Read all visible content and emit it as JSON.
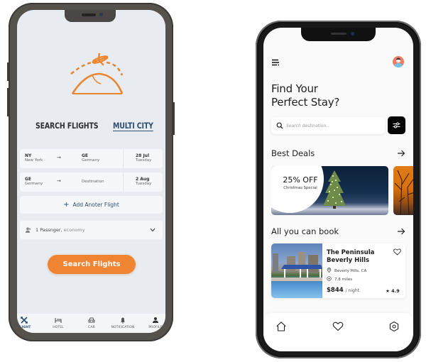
{
  "flight_app": {
    "mode_tabs": [
      {
        "label": "SEARCH FLIGHTS",
        "active": false
      },
      {
        "label": "MULTI CITY",
        "active": true
      }
    ],
    "routes": [
      {
        "from_code": "NY",
        "from_name": "New York",
        "to_code": "GE",
        "to_name": "Germany",
        "date": "28 Jul",
        "day": "Tuesday"
      },
      {
        "from_code": "GE",
        "from_name": "Germany",
        "to_placeholder": "Destination",
        "date": "2 Aug",
        "day": "Tuesday"
      }
    ],
    "add_flight_label": "Add Anoter Flight",
    "passenger": {
      "count_label": "1 Passnger,",
      "class_label": " economy"
    },
    "search_button_label": "Search Flights",
    "bottom_nav": [
      {
        "label": "FLIGHT",
        "icon": "plane-icon",
        "active": true
      },
      {
        "label": "HOTEL",
        "icon": "bed-icon",
        "active": false
      },
      {
        "label": "CAR",
        "icon": "car-icon",
        "active": false
      },
      {
        "label": "NOTIFICATION",
        "icon": "bell-icon",
        "active": false
      },
      {
        "label": "PROFILE",
        "icon": "person-icon",
        "active": false
      }
    ],
    "colors": {
      "accent": "#ef8533",
      "primary": "#2e4e72",
      "background": "#e8ebef"
    }
  },
  "hotel_app": {
    "headline_line1": "Find Your",
    "headline_line2": "Perfect Stay?",
    "search_placeholder": "Search destination...",
    "best_deals_title": "Best Deals",
    "deal": {
      "discount": "25% OFF",
      "subtitle": "Christmas Special"
    },
    "all_book_title": "All you can book",
    "hotel": {
      "name_line1": "The Peninsula",
      "name_line2": "Beverly Hills",
      "location": "Beverly Hills, CA",
      "distance": "7.8 miles",
      "price": "$844",
      "per": "/ night",
      "rating": "4.9"
    },
    "bottom_nav": [
      "home-icon",
      "heart-icon",
      "settings-icon"
    ],
    "colors": {
      "text": "#1f1f1f",
      "avatar": "#ef7d63",
      "filter_button": "#050505"
    }
  }
}
